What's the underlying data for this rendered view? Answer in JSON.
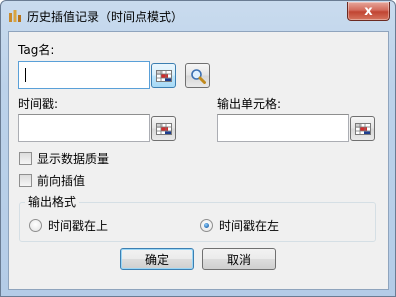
{
  "window": {
    "title": "历史插值记录（时间点模式）",
    "close_glyph": "x"
  },
  "form": {
    "tag_label": "Tag名:",
    "tag_value": "",
    "time_label": "时间戳:",
    "time_value": "",
    "output_cell_label": "输出单元格:",
    "output_cell_value": "",
    "show_quality_label": "显示数据质量",
    "show_quality_checked": false,
    "forward_interp_label": "前向插值",
    "forward_interp_checked": false
  },
  "output_format": {
    "title": "输出格式",
    "options": [
      {
        "label": "时间戳在上",
        "checked": false
      },
      {
        "label": "时间戳在左",
        "checked": true
      }
    ]
  },
  "buttons": {
    "ok_label": "确定",
    "cancel_label": "取消"
  },
  "icons": {
    "cell_picker": "cell-picker-icon",
    "search": "magnifier-icon",
    "app": "app-icon"
  },
  "colors": {
    "accent": "#3c7fb1",
    "close": "#c14532"
  }
}
